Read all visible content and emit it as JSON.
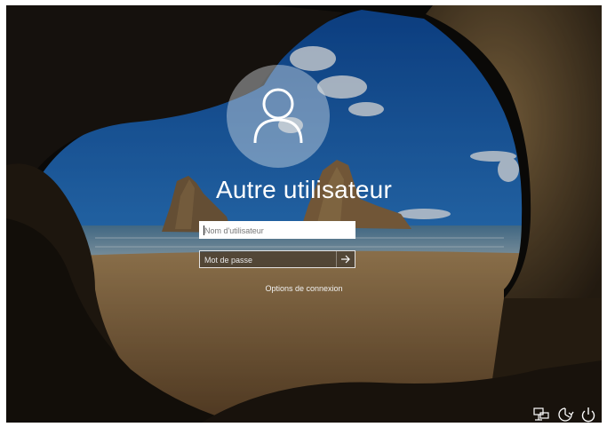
{
  "login": {
    "username_display": "Autre utilisateur",
    "username_field": {
      "placeholder": "Nom d'utilisateur",
      "value": ""
    },
    "password_field": {
      "placeholder": "Mot de passe",
      "value": ""
    },
    "options_link": "Options de connexion"
  },
  "system_tray": {
    "icons": [
      "network-icon",
      "accessibility-icon",
      "power-icon"
    ]
  },
  "colors": {
    "text": "#ffffff",
    "avatar_circle": "#cfd6de"
  }
}
